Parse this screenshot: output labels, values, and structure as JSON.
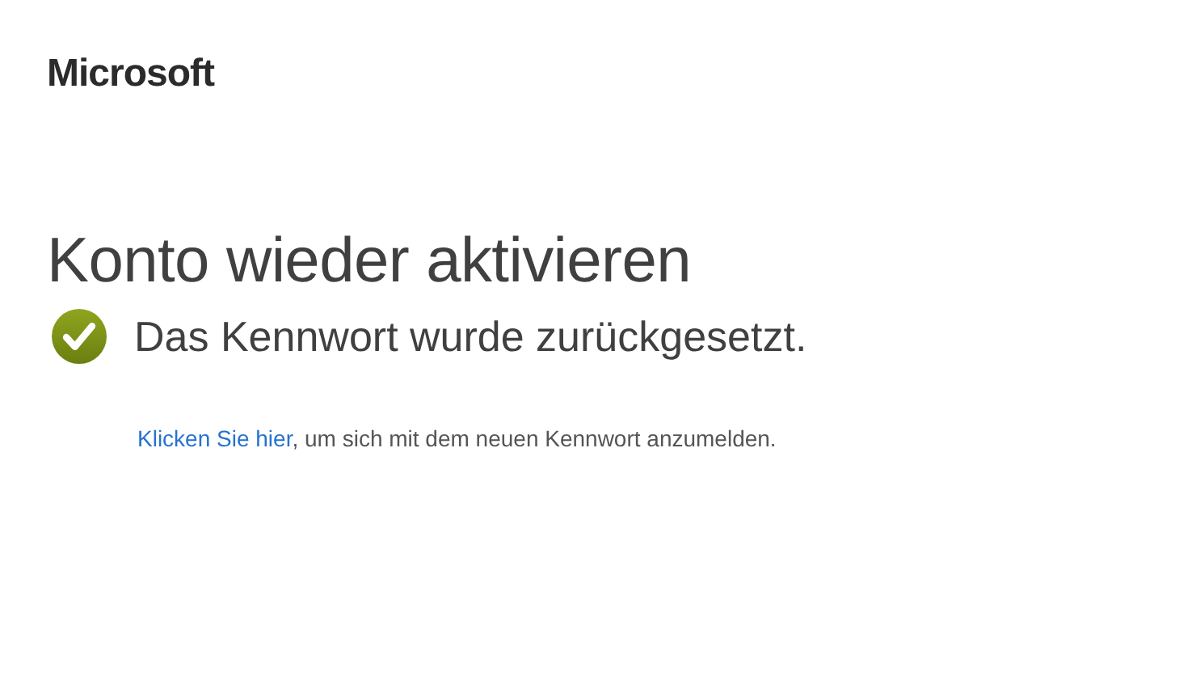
{
  "logo": {
    "text": "Microsoft"
  },
  "title": "Konto wieder aktivieren",
  "status": {
    "kind": "success",
    "message": "Das Kennwort wurde zurückgesetzt."
  },
  "instruction": {
    "link": "Klicken Sie hier",
    "text": ", um sich mit dem neuen Kennwort anzumelden."
  }
}
